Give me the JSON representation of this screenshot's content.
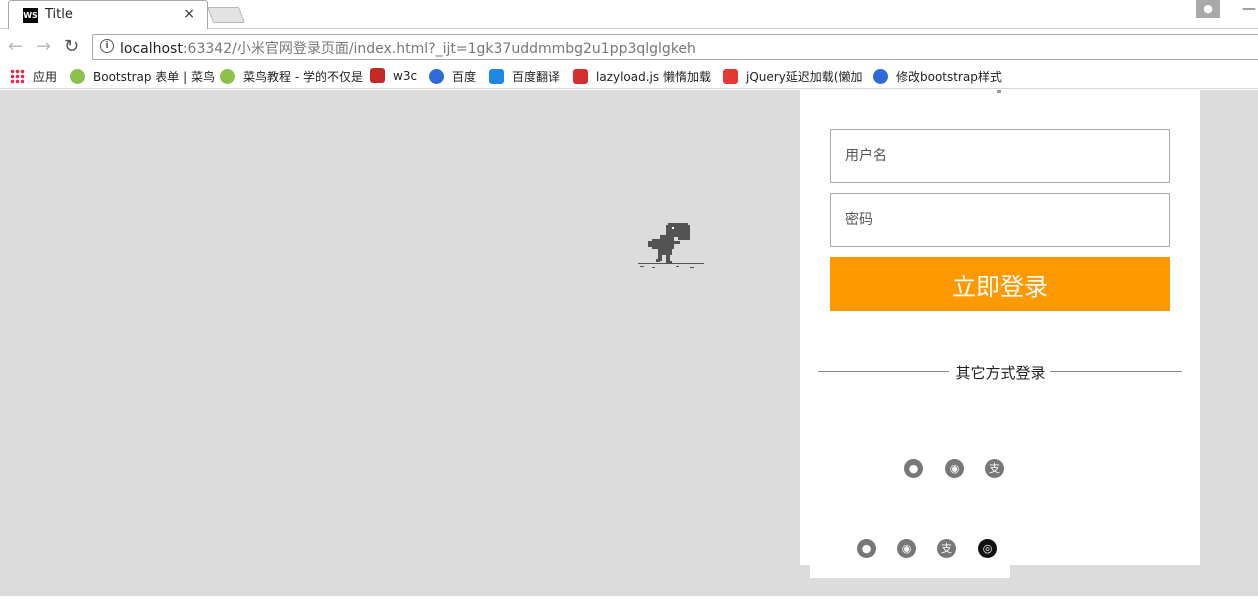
{
  "browser": {
    "tab_title": "Title",
    "tab_favicon": "WS",
    "url_host": "localhost",
    "url_rest": ":63342/小米官网登录页面/index.html?_ijt=1gk37uddmmbg2u1pp3qlglgkeh"
  },
  "bookmarks": [
    {
      "label": "应用",
      "icon": "apps-grid-icon",
      "color": "#e24"
    },
    {
      "label": "Bootstrap 表单 | 菜鸟",
      "icon": "runoob-icon",
      "color": "#8bc34a"
    },
    {
      "label": "菜鸟教程 - 学的不仅是",
      "icon": "runoob-icon",
      "color": "#8bc34a"
    },
    {
      "label": "w3c",
      "icon": "w3c-icon",
      "color": "#c62828"
    },
    {
      "label": "百度",
      "icon": "baidu-paw-icon",
      "color": "#2f6bd8"
    },
    {
      "label": "百度翻译",
      "icon": "translate-icon",
      "color": "#1e88e5"
    },
    {
      "label": "lazyload.js 懒惰加载",
      "icon": "csdn-icon",
      "color": "#d32f2f"
    },
    {
      "label": "jQuery延迟加载(懒加",
      "icon": "w-icon",
      "color": "#e53935"
    },
    {
      "label": "修改bootstrap样式",
      "icon": "baidu-paw-icon",
      "color": "#2f6bd8"
    }
  ],
  "login": {
    "username_placeholder": "用户名",
    "password_placeholder": "密码",
    "submit_label": "立即登录",
    "other_methods": "其它方式登录",
    "accent_color": "#ff9900"
  },
  "social_icons_top": [
    "qq-icon",
    "weibo-icon",
    "alipay-icon"
  ],
  "social_icons_bottom": [
    "qq-icon",
    "weibo-icon",
    "alipay-icon",
    "wechat-icon"
  ],
  "glyphs": {
    "back": "←",
    "forward": "→",
    "reload": "↻",
    "close": "×",
    "minimize": "—",
    "info": "i",
    "profile": "●",
    "social_top": [
      "●",
      "◉",
      "支"
    ],
    "social_bottom": [
      "●",
      "◉",
      "支",
      "◎"
    ]
  }
}
